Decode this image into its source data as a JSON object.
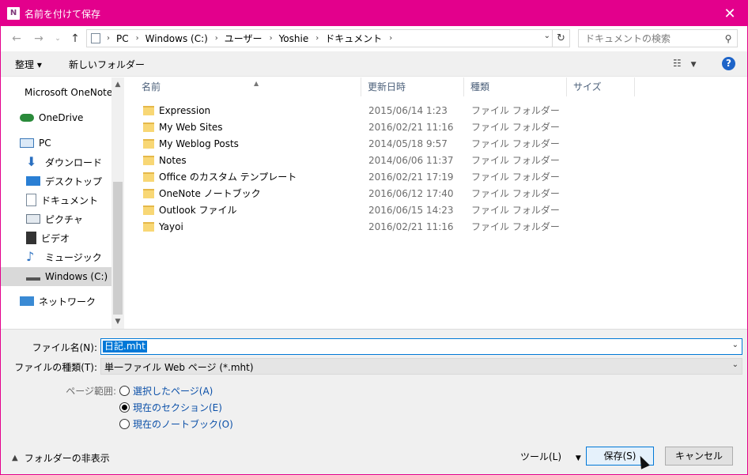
{
  "window": {
    "title": "名前を付けて保存",
    "app_icon": "onenote-icon",
    "accent": "#e3008c"
  },
  "nav": {
    "breadcrumb": [
      "PC",
      "Windows (C:)",
      "ユーザー",
      "Yoshie",
      "ドキュメント"
    ],
    "search_placeholder": "ドキュメントの検索"
  },
  "toolbar": {
    "organize_label": "整理 ▾",
    "new_folder_label": "新しいフォルダー",
    "help_label": "?"
  },
  "sidebar": {
    "items": [
      {
        "label": "Microsoft OneNote",
        "icon": "onenote-icon"
      },
      {
        "label": "OneDrive",
        "icon": "onedrive-icon"
      },
      {
        "label": "PC",
        "icon": "pc-icon"
      },
      {
        "label": "ダウンロード",
        "icon": "download-icon"
      },
      {
        "label": "デスクトップ",
        "icon": "desktop-icon"
      },
      {
        "label": "ドキュメント",
        "icon": "document-icon"
      },
      {
        "label": "ピクチャ",
        "icon": "picture-icon"
      },
      {
        "label": "ビデオ",
        "icon": "video-icon"
      },
      {
        "label": "ミュージック",
        "icon": "music-icon"
      },
      {
        "label": "Windows (C:)",
        "icon": "drive-icon",
        "selected": true
      },
      {
        "label": "ネットワーク",
        "icon": "network-icon"
      }
    ]
  },
  "files": {
    "columns": [
      "名前",
      "更新日時",
      "種類",
      "サイズ"
    ],
    "rows": [
      {
        "name": "Expression",
        "date": "2015/06/14 1:23",
        "type": "ファイル フォルダー"
      },
      {
        "name": "My Web Sites",
        "date": "2016/02/21 11:16",
        "type": "ファイル フォルダー"
      },
      {
        "name": "My Weblog Posts",
        "date": "2014/05/18 9:57",
        "type": "ファイル フォルダー"
      },
      {
        "name": "Notes",
        "date": "2014/06/06 11:37",
        "type": "ファイル フォルダー"
      },
      {
        "name": "Office のカスタム テンプレート",
        "date": "2016/02/21 17:19",
        "type": "ファイル フォルダー"
      },
      {
        "name": "OneNote ノートブック",
        "date": "2016/06/12 17:40",
        "type": "ファイル フォルダー"
      },
      {
        "name": "Outlook ファイル",
        "date": "2016/06/15 14:23",
        "type": "ファイル フォルダー"
      },
      {
        "name": "Yayoi",
        "date": "2016/02/21 11:16",
        "type": "ファイル フォルダー"
      }
    ]
  },
  "save": {
    "filename_label": "ファイル名(N):",
    "filename_value": "日記.mht",
    "filetype_label": "ファイルの種類(T):",
    "filetype_value": "単一ファイル Web ページ (*.mht)",
    "page_range_label": "ページ範囲:",
    "options": [
      {
        "label": "選択したページ(A)",
        "checked": false
      },
      {
        "label": "現在のセクション(E)",
        "checked": true
      },
      {
        "label": "現在のノートブック(O)",
        "checked": false
      }
    ],
    "hide_folders_label": "フォルダーの非表示",
    "tools_label": "ツール(L)",
    "save_label": "保存(S)",
    "cancel_label": "キャンセル"
  }
}
